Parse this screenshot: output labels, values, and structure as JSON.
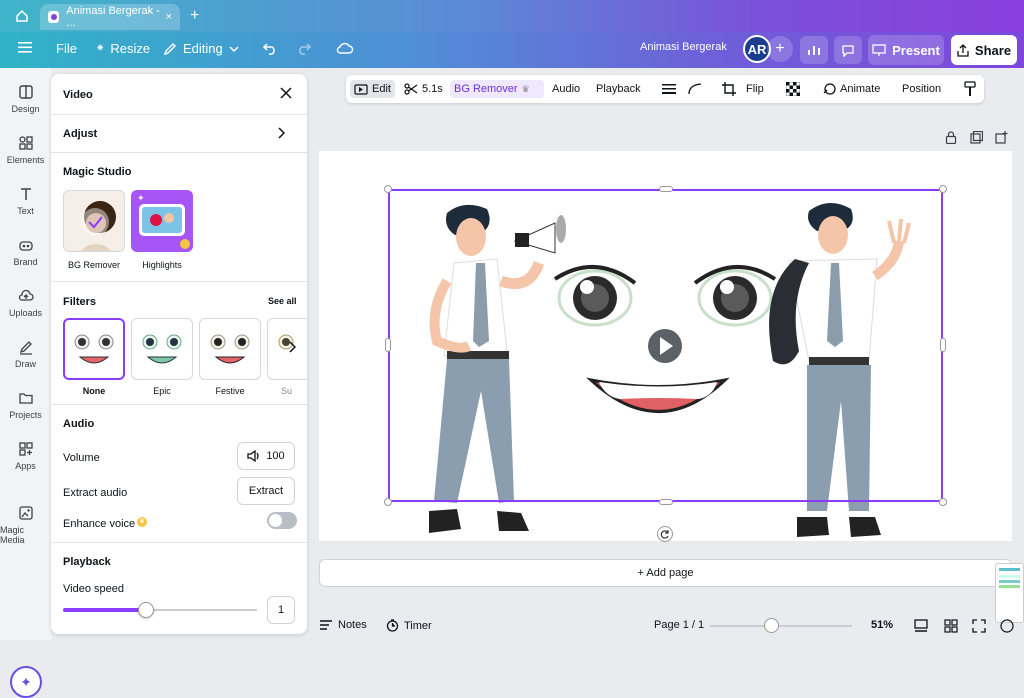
{
  "tab": {
    "title": "Animasi Bergerak - ...",
    "close": "×",
    "new": "+"
  },
  "topbar": {
    "menu": "File",
    "resize": "Resize",
    "editing": "Editing",
    "doc_title": "Animasi Bergerak",
    "avatar": "AR",
    "present": "Present",
    "share": "Share"
  },
  "rail": [
    {
      "label": "Design",
      "icon": "design-icon"
    },
    {
      "label": "Elements",
      "icon": "elements-icon"
    },
    {
      "label": "Text",
      "icon": "text-icon"
    },
    {
      "label": "Brand",
      "icon": "brand-icon"
    },
    {
      "label": "Uploads",
      "icon": "uploads-icon"
    },
    {
      "label": "Draw",
      "icon": "draw-icon"
    },
    {
      "label": "Projects",
      "icon": "projects-icon"
    },
    {
      "label": "Apps",
      "icon": "apps-icon"
    },
    {
      "label": "Magic Media",
      "icon": "magic-media-icon"
    }
  ],
  "panel": {
    "title": "Video",
    "adjust": "Adjust",
    "magic_studio": "Magic Studio",
    "bg_remover": "BG Remover",
    "highlights": "Highlights",
    "filters": "Filters",
    "see_all": "See all",
    "filter_items": [
      "None",
      "Epic",
      "Festive",
      "Su"
    ],
    "audio": "Audio",
    "volume_label": "Volume",
    "volume_value": "100",
    "extract_label": "Extract audio",
    "extract_button": "Extract",
    "enhance_label": "Enhance voice",
    "playback": "Playback",
    "speed_label": "Video speed",
    "speed_value": "1"
  },
  "toolbar": {
    "edit": "Edit",
    "duration": "5.1s",
    "bg_remover": "BG Remover",
    "audio": "Audio",
    "playback": "Playback",
    "flip": "Flip",
    "animate": "Animate",
    "position": "Position"
  },
  "canvas": {
    "add_page": "+ Add page"
  },
  "bottom": {
    "notes": "Notes",
    "timer": "Timer",
    "page": "Page 1 / 1",
    "zoom": "51%"
  },
  "colors": {
    "accent": "#8b3dff",
    "toggle_off": "#b9bec4"
  }
}
